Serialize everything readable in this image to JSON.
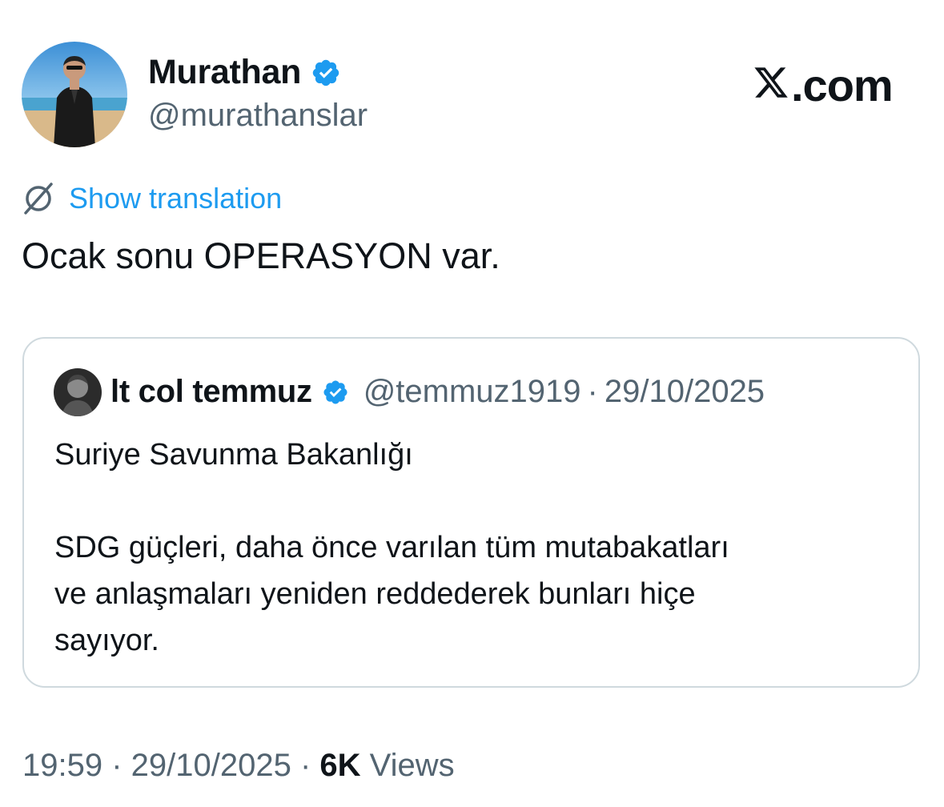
{
  "author": {
    "name": "Murathan",
    "handle": "@murathanslar",
    "verified": true
  },
  "brand": {
    "text": ".com",
    "logo_icon": "x-logo-icon"
  },
  "translation": {
    "link_label": "Show translation",
    "icon": "translate-icon"
  },
  "tweet": {
    "text": "Ocak sonu OPERASYON var."
  },
  "quoted_tweet": {
    "author_name": "lt col temmuz",
    "handle": "@temmuz1919",
    "separator": "·",
    "date": "29/10/2025",
    "verified": true,
    "text": "Suriye Savunma Bakanlığı\n\nSDG güçleri, daha önce varılan tüm mutabakatları\nve anlaşmaları yeniden reddederek bunları hiçe\nsayıyor."
  },
  "meta": {
    "time": "19:59",
    "separator": " · ",
    "date": "29/10/2025",
    "views_count": "6K",
    "views_label": " Views"
  },
  "colors": {
    "text": "#0f1419",
    "secondary": "#536471",
    "link": "#1d9bf0",
    "verified": "#1d9bf0",
    "border": "#cfd9de"
  }
}
